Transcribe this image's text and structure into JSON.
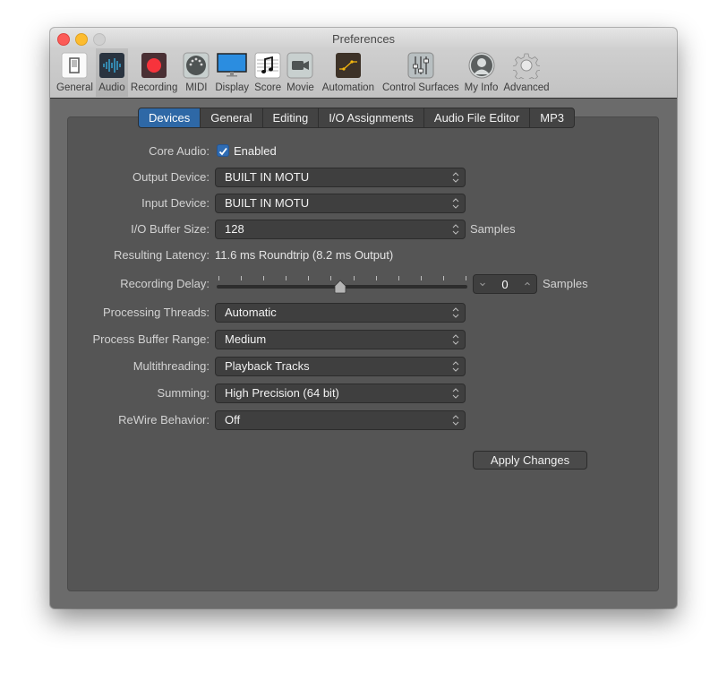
{
  "window": {
    "title": "Preferences"
  },
  "toolbar": {
    "items": [
      {
        "label": "General",
        "icon": "general-switch-icon"
      },
      {
        "label": "Audio",
        "icon": "audio-waveform-icon",
        "active": true
      },
      {
        "label": "Recording",
        "icon": "record-icon"
      },
      {
        "label": "MIDI",
        "icon": "midi-connector-icon"
      },
      {
        "label": "Display",
        "icon": "display-monitor-icon"
      },
      {
        "label": "Score",
        "icon": "score-note-icon"
      },
      {
        "label": "Movie",
        "icon": "movie-camera-icon"
      },
      {
        "label": "Automation",
        "icon": "automation-curve-icon"
      },
      {
        "label": "Control Surfaces",
        "icon": "faders-icon"
      },
      {
        "label": "My Info",
        "icon": "user-avatar-icon"
      },
      {
        "label": "Advanced",
        "icon": "gear-icon"
      }
    ]
  },
  "tabs": [
    {
      "label": "Devices",
      "active": true
    },
    {
      "label": "General"
    },
    {
      "label": "Editing"
    },
    {
      "label": "I/O Assignments"
    },
    {
      "label": "Audio File Editor"
    },
    {
      "label": "MP3"
    }
  ],
  "devices": {
    "core_audio": {
      "label": "Core Audio:",
      "checkbox_label": "Enabled",
      "checked": true
    },
    "output_device": {
      "label": "Output Device:",
      "value": "BUILT IN MOTU"
    },
    "input_device": {
      "label": "Input Device:",
      "value": "BUILT IN MOTU"
    },
    "io_buffer_size": {
      "label": "I/O Buffer Size:",
      "value": "128",
      "unit": "Samples"
    },
    "resulting_latency": {
      "label": "Resulting Latency:",
      "value": "11.6 ms Roundtrip (8.2 ms Output)"
    },
    "recording_delay": {
      "label": "Recording Delay:",
      "value": "0",
      "unit": "Samples",
      "slider_position": 0.5
    },
    "processing_threads": {
      "label": "Processing Threads:",
      "value": "Automatic"
    },
    "process_buffer_range": {
      "label": "Process Buffer Range:",
      "value": "Medium"
    },
    "multithreading": {
      "label": "Multithreading:",
      "value": "Playback Tracks"
    },
    "summing": {
      "label": "Summing:",
      "value": "High Precision (64 bit)"
    },
    "rewire_behavior": {
      "label": "ReWire Behavior:",
      "value": "Off"
    }
  },
  "apply_button": {
    "label": "Apply Changes"
  }
}
